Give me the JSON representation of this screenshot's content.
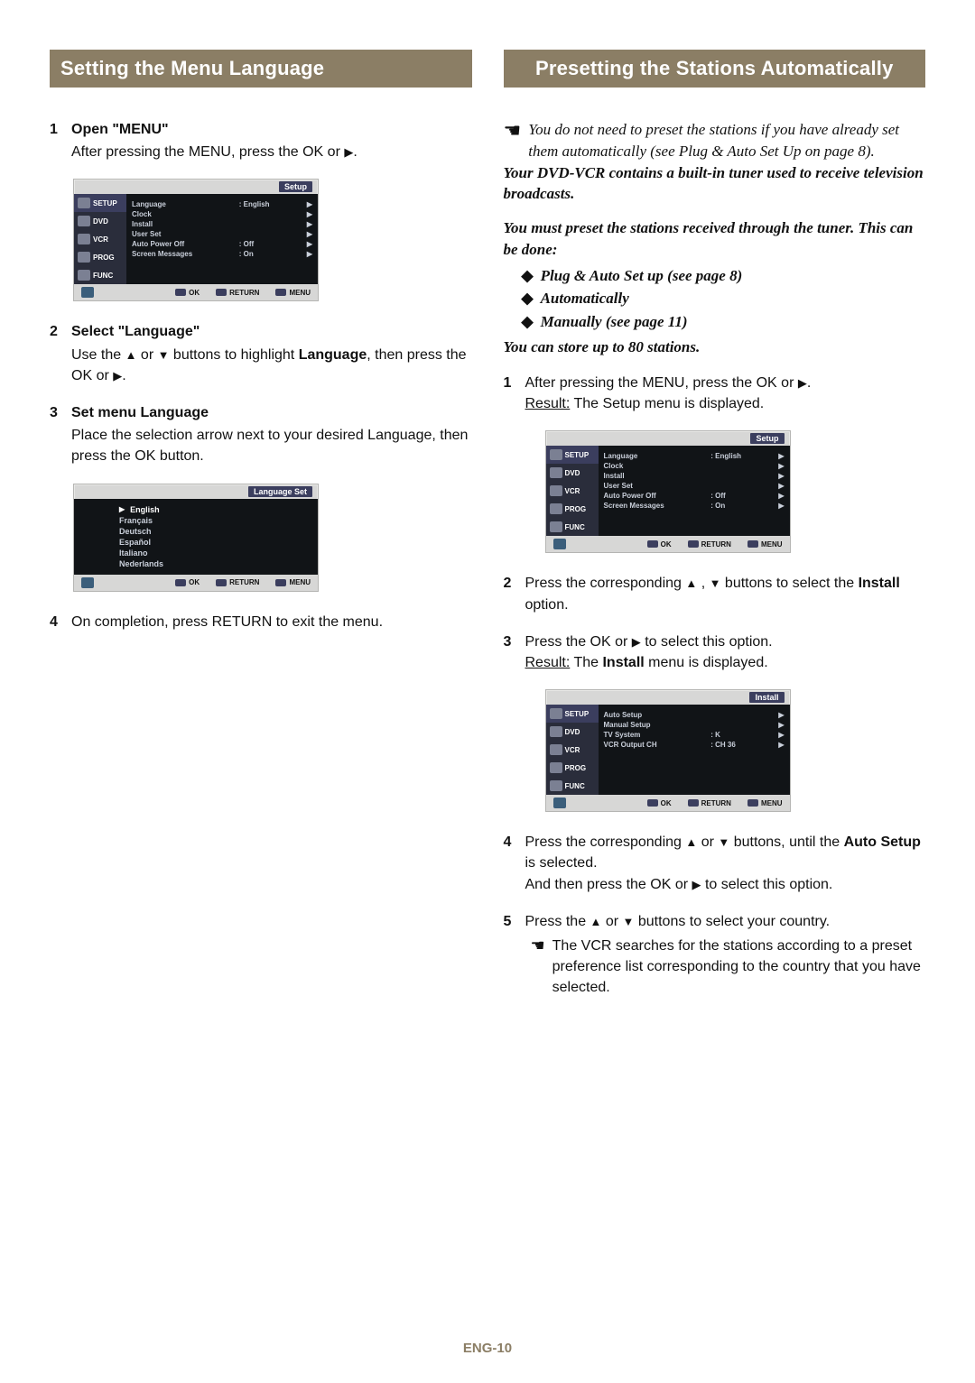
{
  "left": {
    "title": "Setting the Menu Language",
    "s1_head": "Open \"MENU\"",
    "s1_body_a": "After pressing the MENU, press the OK or ",
    "s1_body_b": ".",
    "s2_head": "Select \"Language\"",
    "s2_body_a": "Use the ",
    "s2_body_b": " or ",
    "s2_body_c": " buttons to highlight ",
    "s2_body_bold": "Language",
    "s2_body_d": ", then press the OK or ",
    "s2_body_e": ".",
    "s3_head": "Set menu Language",
    "s3_body": "Place the selection arrow next to your desired Language, then press the OK button.",
    "s4_body": "On completion, press RETURN to exit the menu."
  },
  "right": {
    "title": "Presetting the Stations Automatically",
    "lead1": "You do not need to preset the stations if you have already set them automatically (see Plug & Auto Set Up on page 8).",
    "lead2": "Your DVD-VCR contains a built-in tuner used to receive television broadcasts.",
    "lead3": "You must preset the stations received through the tuner. This can be done:",
    "bul1": "Plug & Auto Set up (see page 8)",
    "bul2": "Automatically",
    "bul3": "Manually (see page 11)",
    "lead4": "You can store up to 80 stations.",
    "r1a": "After pressing the MENU, press the OK or ",
    "r1b": ".",
    "r1c": "Result:",
    "r1d": "  The Setup menu is displayed.",
    "r2a": "Press the corresponding ",
    "r2b": " , ",
    "r2c": " buttons to select the ",
    "r2bold": "Install",
    "r2d": " option.",
    "r3a": "Press the OK or ",
    "r3b": " to select this option.",
    "r3c": "Result:",
    "r3d": "  The ",
    "r3bold": "Install",
    "r3e": " menu is displayed.",
    "r4a": "Press the corresponding ",
    "r4b": " or ",
    "r4c": " buttons, until the ",
    "r4bold": "Auto Setup",
    "r4d": " is selected.",
    "r4e": "And then press the OK or ",
    "r4f": " to select this option.",
    "r5a": "Press the ",
    "r5b": " or ",
    "r5c": " buttons to select your country.",
    "r5note": "The VCR searches for the stations according to a preset preference list corresponding to the country that you have selected."
  },
  "osd": {
    "tab_setup": "Setup",
    "tab_lang": "Language Set",
    "tab_install": "Install",
    "side": [
      "SETUP",
      "DVD",
      "VCR",
      "PROG",
      "FUNC"
    ],
    "setup_rows": [
      {
        "c1": "Language",
        "c2": ": English",
        "c3": "▶"
      },
      {
        "c1": "Clock",
        "c2": "",
        "c3": "▶"
      },
      {
        "c1": "Install",
        "c2": "",
        "c3": "▶"
      },
      {
        "c1": "User Set",
        "c2": "",
        "c3": "▶"
      },
      {
        "c1": "Auto Power Off",
        "c2": ": Off",
        "c3": "▶"
      },
      {
        "c1": "Screen Messages",
        "c2": ": On",
        "c3": "▶"
      }
    ],
    "lang_rows": [
      "English",
      "Français",
      "Deutsch",
      "Español",
      "Italiano",
      "Nederlands"
    ],
    "install_rows": [
      {
        "c1": "Auto Setup",
        "c2": "",
        "c3": "▶"
      },
      {
        "c1": "Manual Setup",
        "c2": "",
        "c3": "▶"
      },
      {
        "c1": "TV System",
        "c2": ": K",
        "c3": "▶"
      },
      {
        "c1": "VCR Output CH",
        "c2": ": CH 36",
        "c3": "▶"
      }
    ],
    "foot_ok": "OK",
    "foot_return": "RETURN",
    "foot_menu": "MENU"
  },
  "page_num": "ENG-10"
}
